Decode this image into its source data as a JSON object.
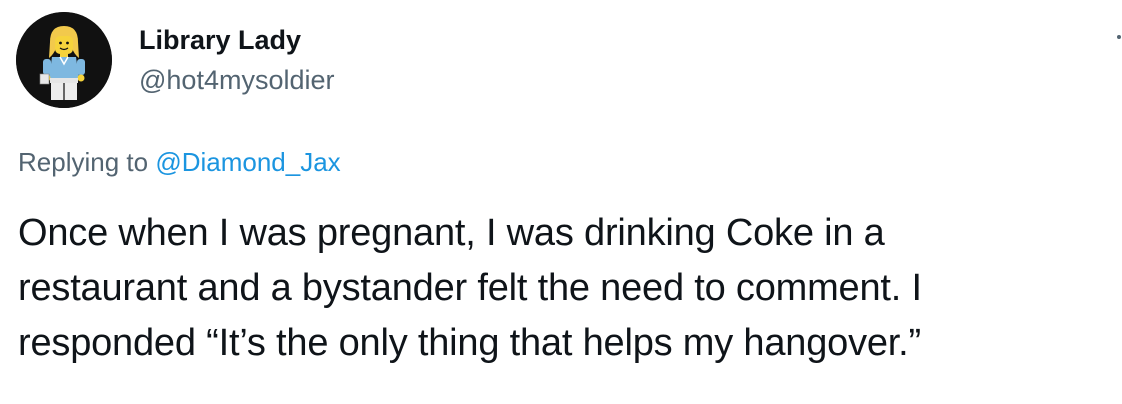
{
  "author": {
    "display_name": "Library Lady",
    "handle": "@hot4mysoldier",
    "avatar_icon": "lego-minifigure-avatar"
  },
  "reply": {
    "prefix": "Replying to",
    "mention": "@Diamond_Jax"
  },
  "tweet": {
    "lines": [
      "Once when I was pregnant, I was drinking Coke in a",
      "restaurant and a bystander felt the need to comment. I",
      "responded “It’s the only thing that helps my hangover.”"
    ]
  },
  "colors": {
    "text": "#0f1419",
    "secondary": "#536471",
    "link": "#1b95e0",
    "avatar_bg": "#111111"
  }
}
